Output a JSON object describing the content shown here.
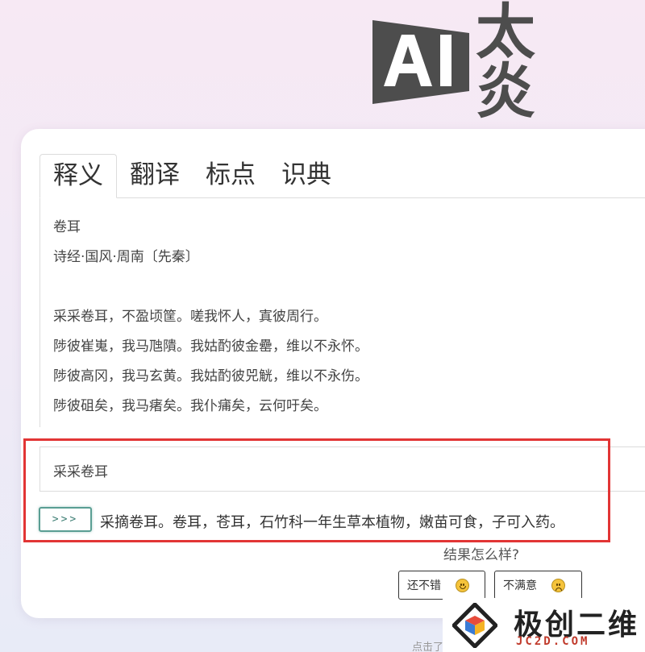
{
  "logo": {
    "text": "AI",
    "suffix": "太炎",
    "color": "#4d4d4d"
  },
  "tabs": [
    {
      "label": "释义",
      "active": true
    },
    {
      "label": "翻译",
      "active": false
    },
    {
      "label": "标点",
      "active": false
    },
    {
      "label": "识典",
      "active": false
    }
  ],
  "poem": {
    "title": "卷耳",
    "author": "诗经·国风·周南〔先秦〕",
    "lines": [
      "采采卷耳，不盈顷筐。嗟我怀人，寘彼周行。",
      "陟彼崔嵬，我马虺隤。我姑酌彼金罍，维以不永怀。",
      "陟彼高冈，我马玄黄。我姑酌彼兕觥，维以不永伤。",
      "陟彼砠矣，我马瘏矣。我仆痡矣，云何吁矣。"
    ]
  },
  "query": {
    "value": "采采卷耳"
  },
  "result": {
    "button_label": ">>>",
    "text": "采摘卷耳。卷耳，苍耳，石竹科一年生草本植物，嫩苗可食，子可入药。"
  },
  "feedback": {
    "question": "结果怎么样?",
    "good_label": "还不错",
    "bad_label": "不满意"
  },
  "watermark": {
    "title": "极创二维",
    "sub": "JC2D.COM"
  },
  "footer": {
    "hint": "点击了"
  },
  "colors": {
    "accent": "#5a9e93",
    "highlight": "#e23535"
  }
}
